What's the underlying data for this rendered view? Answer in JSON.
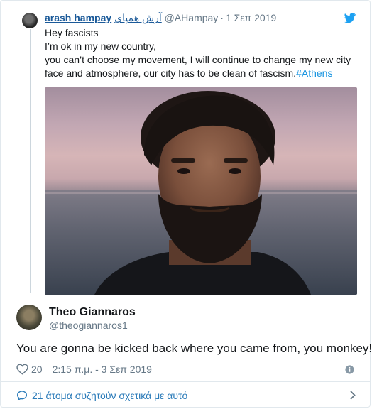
{
  "quoted": {
    "name": "arash hampay",
    "name_local": "آرش همپای",
    "handle": "@AHampay",
    "date": "1 Σεπ 2019",
    "lines": [
      "Hey fascists",
      "I’m ok in my new country,",
      "you can’t choose my movement, I will continue to change my new city",
      "face and atmosphere, our city has to be clean of fascism."
    ],
    "hashtag": "#Athens"
  },
  "main": {
    "name": "Theo Giannaros",
    "handle": "@theogiannaros1",
    "text": "You are gonna be kicked back where you came from, you monkey!",
    "likes": "20",
    "timestamp": "2:15 π.μ. - 3 Σεπ 2019"
  },
  "footer": {
    "conversation": "21 άτομα συζητούν σχετικά με αυτό"
  },
  "colors": {
    "link": "#1b95e0",
    "name_link": "#1b5a99",
    "muted": "#657786",
    "border": "#e1e8ed"
  }
}
